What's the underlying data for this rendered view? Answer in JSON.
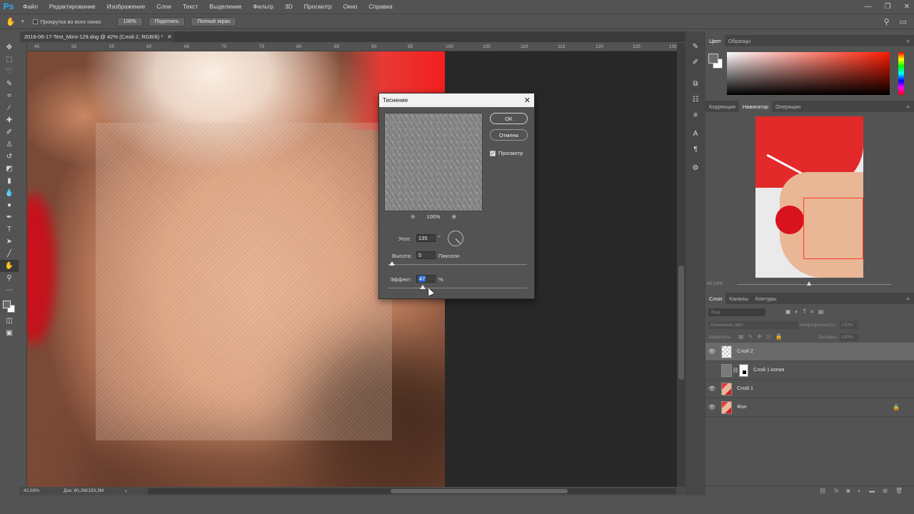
{
  "menu": {
    "logo": "Ps",
    "items": [
      "Файл",
      "Редактирование",
      "Изображение",
      "Слои",
      "Текст",
      "Выделение",
      "Фильтр",
      "3D",
      "Просмотр",
      "Окно",
      "Справка"
    ],
    "window_controls": [
      "—",
      "❐",
      "✕"
    ]
  },
  "options": {
    "scroll_all_label": "Прокрутка во всех окнах",
    "zoom_100": "100%",
    "fit_label": "Подогнать",
    "fullscreen_label": "Полный экран"
  },
  "document": {
    "tab_title": "2016-06-17-Test_Mimi-129.dng @ 42% (Слой 2, RGB/8) *",
    "ruler_ticks": [
      "45",
      "50",
      "55",
      "60",
      "65",
      "70",
      "75",
      "80",
      "85",
      "90",
      "95",
      "100",
      "105",
      "110",
      "115",
      "120",
      "125",
      "130"
    ]
  },
  "status": {
    "zoom": "42,03%",
    "doc_size": "Док: 60,2M/193,3M",
    "arrow": "›"
  },
  "dialog": {
    "title": "Тиснение",
    "close": "✕",
    "preview_zoom": "100%",
    "zoom_out_icon": "⊖",
    "zoom_in_icon": "⊕",
    "ok_label": "OK",
    "cancel_label": "Отмена",
    "preview_label": "Просмотр",
    "preview_checked": true,
    "angle_label": "Угол:",
    "angle_value": "135",
    "angle_unit": "°",
    "height_label": "Высота:",
    "height_value": "5",
    "height_unit": "Пиксели",
    "effect_label": "Эффект:",
    "effect_value": "47",
    "effect_unit": "%"
  },
  "panels": {
    "color_tabs": [
      "Цвет",
      "Образцы"
    ],
    "nav_tabs": [
      "Коррекция",
      "Навигатор",
      "Операции"
    ],
    "nav_zoom": "42,03%",
    "layers_tabs": [
      "Слои",
      "Каналы",
      "Контуры"
    ],
    "kind_placeholder": "Вид",
    "blend_mode": "Линейный свет",
    "opacity_label": "Непрозрачность:",
    "opacity_value": "100%",
    "lock_label": "Закрепить:",
    "fill_label": "Заливка:",
    "fill_value": "100%",
    "layers": [
      {
        "name": "Слой 2",
        "visible": true,
        "selected": true
      },
      {
        "name": "Слой 1 копия",
        "visible": false,
        "selected": false
      },
      {
        "name": "Слой 1",
        "visible": true,
        "selected": false
      },
      {
        "name": "Фон",
        "visible": true,
        "selected": false,
        "locked": true
      }
    ]
  }
}
